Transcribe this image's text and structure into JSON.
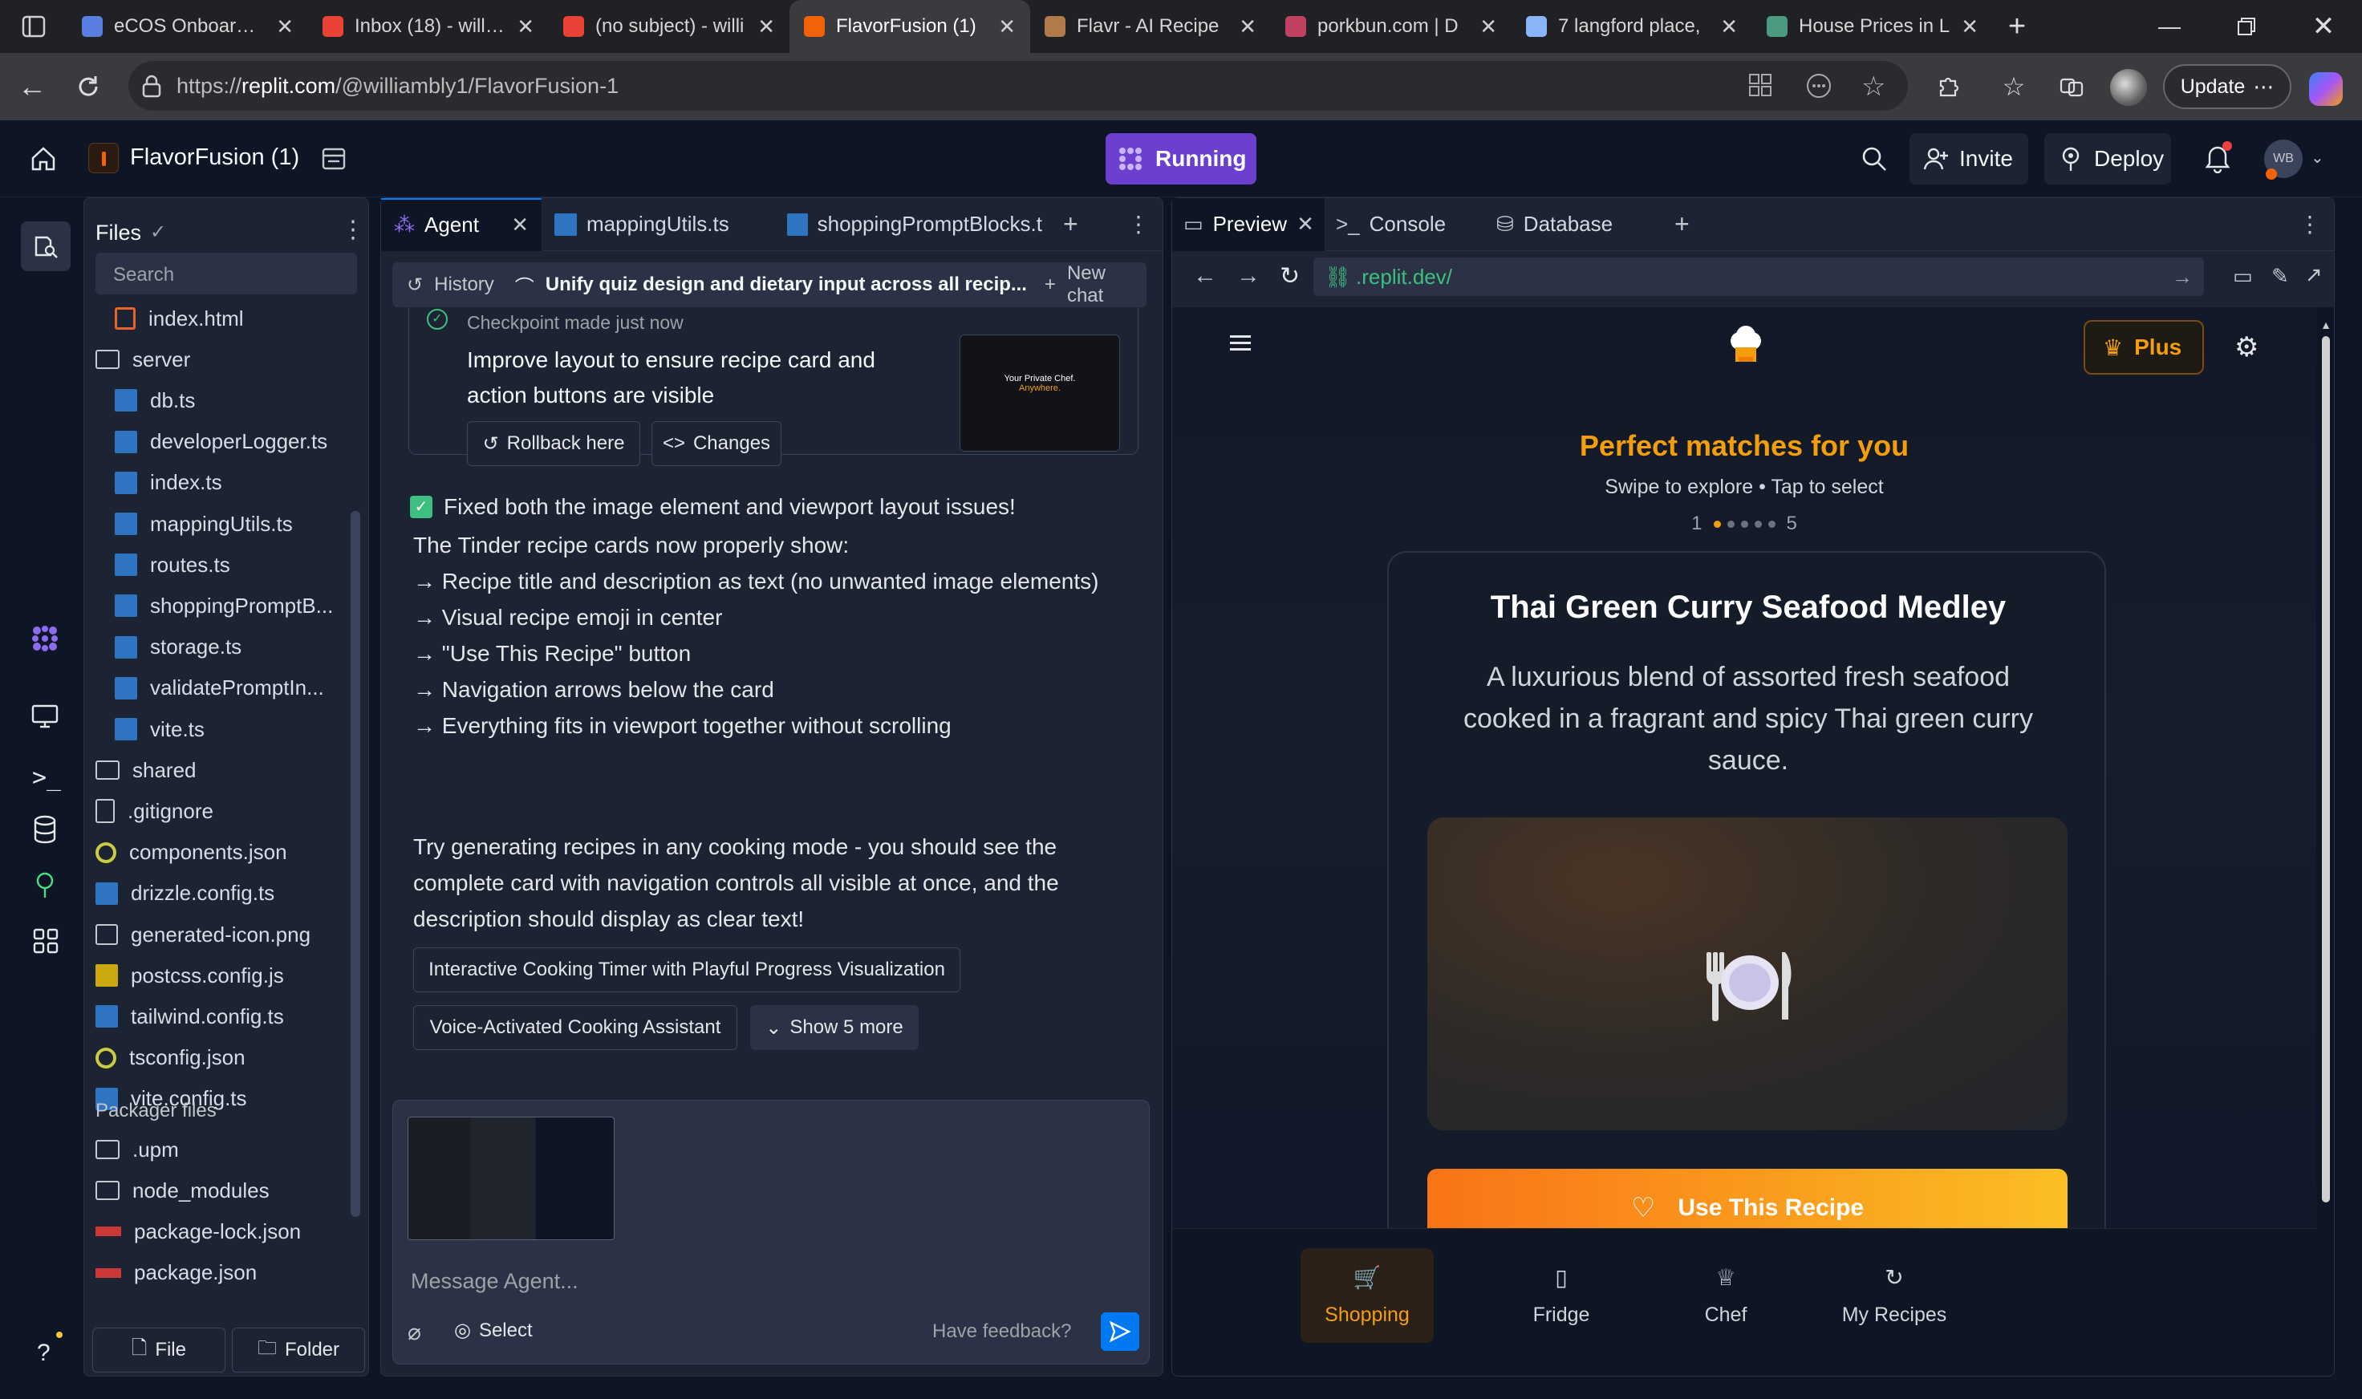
{
  "browser": {
    "tabs": [
      {
        "label": "eCOS Onboarding",
        "color": "#5b7fe0"
      },
      {
        "label": "Inbox (18) - william",
        "color": "#ea4335"
      },
      {
        "label": "(no subject) - willi",
        "color": "#ea4335"
      },
      {
        "label": "FlavorFusion (1)",
        "color": "#f26207"
      },
      {
        "label": "Flavr - AI Recipe",
        "color": "#b07a4a"
      },
      {
        "label": "porkbun.com | D",
        "color": "#c04060"
      },
      {
        "label": "7 langford place,",
        "color": "#8ab4f8"
      },
      {
        "label": "House Prices in L",
        "color": "#4c9a7f"
      }
    ],
    "url_prefix": "https://",
    "url_host": "replit.com",
    "url_path": "/@williambly1/FlavorFusion-1",
    "update_label": "Update"
  },
  "topbar": {
    "project_name": "FlavorFusion (1)",
    "status": "Running",
    "invite_label": "Invite",
    "deploy_label": "Deploy",
    "avatar_initials": "WB"
  },
  "files": {
    "title": "Files",
    "search_placeholder": "Search",
    "items": [
      {
        "name": "index.html",
        "type": "html",
        "indent": 1
      },
      {
        "name": "server",
        "type": "folder",
        "indent": 0
      },
      {
        "name": "db.ts",
        "type": "ts",
        "indent": 1
      },
      {
        "name": "developerLogger.ts",
        "type": "ts",
        "indent": 1
      },
      {
        "name": "index.ts",
        "type": "ts",
        "indent": 1
      },
      {
        "name": "mappingUtils.ts",
        "type": "ts",
        "indent": 1
      },
      {
        "name": "routes.ts",
        "type": "ts",
        "indent": 1
      },
      {
        "name": "shoppingPromptB...",
        "type": "ts",
        "indent": 1
      },
      {
        "name": "storage.ts",
        "type": "ts",
        "indent": 1
      },
      {
        "name": "validatePromptIn...",
        "type": "ts",
        "indent": 1
      },
      {
        "name": "vite.ts",
        "type": "ts",
        "indent": 1
      },
      {
        "name": "shared",
        "type": "folder",
        "indent": 0
      },
      {
        "name": ".gitignore",
        "type": "file",
        "indent": 0
      },
      {
        "name": "components.json",
        "type": "json",
        "indent": 0
      },
      {
        "name": "drizzle.config.ts",
        "type": "ts",
        "indent": 0
      },
      {
        "name": "generated-icon.png",
        "type": "image",
        "indent": 0
      },
      {
        "name": "postcss.config.js",
        "type": "js",
        "indent": 0
      },
      {
        "name": "tailwind.config.ts",
        "type": "ts",
        "indent": 0
      },
      {
        "name": "tsconfig.json",
        "type": "json",
        "indent": 0
      },
      {
        "name": "vite.config.ts",
        "type": "ts",
        "indent": 0
      }
    ],
    "packager_title": "Packager files",
    "packager_items": [
      {
        "name": ".upm",
        "type": "folder"
      },
      {
        "name": "node_modules",
        "type": "folder"
      },
      {
        "name": "package-lock.json",
        "type": "npm"
      },
      {
        "name": "package.json",
        "type": "npm"
      }
    ],
    "file_button": "File",
    "folder_button": "Folder"
  },
  "agent": {
    "tabs": [
      "Agent",
      "mappingUtils.ts",
      "shoppingPromptBlocks.t"
    ],
    "history_label": "History",
    "chat_title": "Unify quiz design and dietary input across all recip...",
    "new_chat_label": "New chat",
    "checkpoint_text": "Checkpoint made just now",
    "checkpoint_desc_1": "Improve layout to ensure recipe card and",
    "checkpoint_desc_2": "action buttons are visible",
    "thumb_line1": "Your Private Chef.",
    "thumb_line2": "Anywhere.",
    "rollback_label": "Rollback here",
    "changes_label": "Changes",
    "fixed_line": "Fixed both the image element and viewport layout issues!",
    "body_lines": [
      "The Tinder recipe cards now properly show:",
      "→ Recipe title and description as text (no unwanted image elements)",
      "→ Visual recipe emoji in center",
      "→ \"Use This Recipe\" button",
      "→ Navigation arrows below the card",
      "→ Everything fits in viewport together without scrolling"
    ],
    "closing_lines": [
      "Try generating recipes in any cooking mode - you should see the",
      "complete card with navigation controls all visible at once, and the",
      "description should display as clear text!"
    ],
    "suggestion_1": "Interactive Cooking Timer with Playful Progress Visualization",
    "suggestion_2": "Voice-Activated Cooking Assistant",
    "show_more": "Show 5 more",
    "message_placeholder": "Message Agent...",
    "select_label": "Select",
    "feedback_label": "Have feedback?"
  },
  "preview": {
    "tabs": [
      "Preview",
      "Console",
      "Database"
    ],
    "url": ".replit.dev/",
    "plus_label": "Plus",
    "heading": "Perfect matches for you",
    "subheading": "Swipe to explore • Tap to select",
    "page_start": "1",
    "page_end": "5",
    "current_page": 1,
    "total_pages": 5,
    "recipe_title": "Thai Green Curry Seafood Medley",
    "recipe_desc_1": "A luxurious blend of assorted fresh seafood",
    "recipe_desc_2": "cooked in a fragrant and spicy Thai green curry",
    "recipe_desc_3": "sauce.",
    "use_recipe_label": "Use This Recipe",
    "nav": [
      "Shopping",
      "Fridge",
      "Chef",
      "My Recipes"
    ],
    "active_nav": "Shopping",
    "accent": "#f59e0b"
  }
}
